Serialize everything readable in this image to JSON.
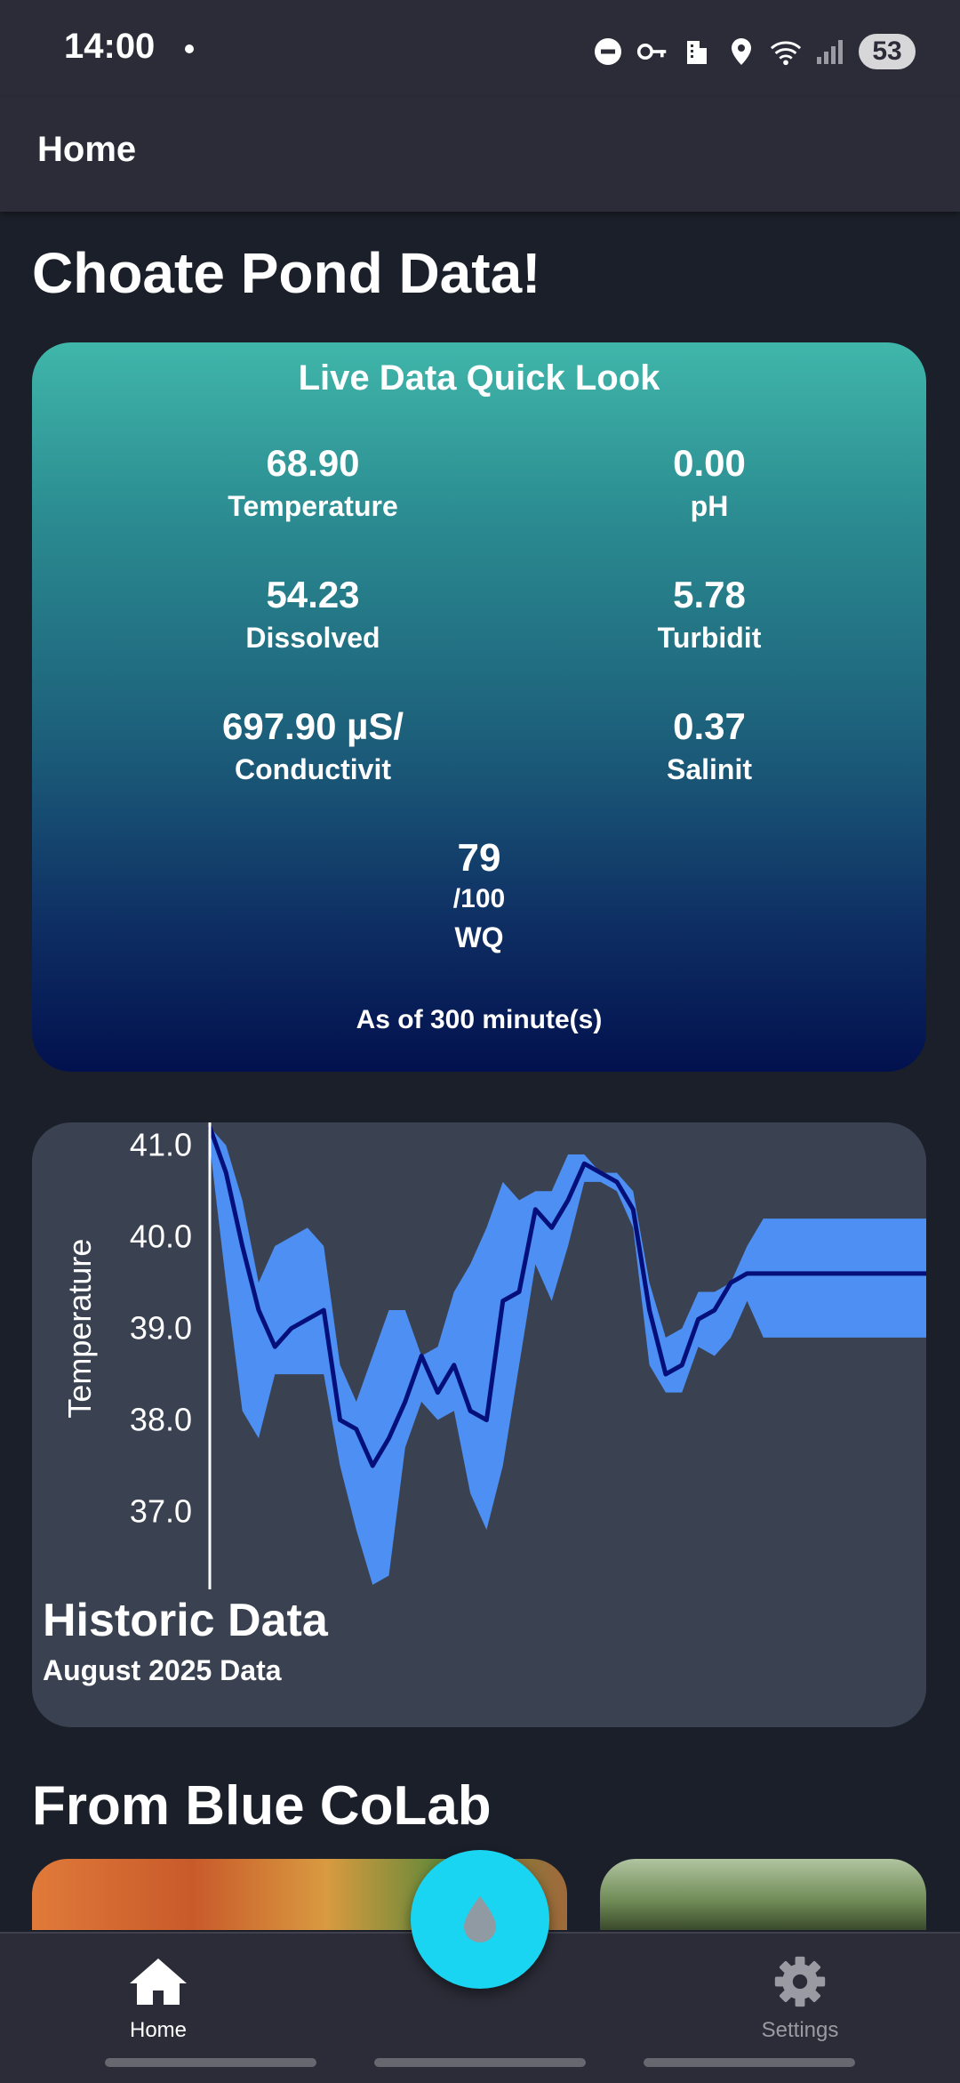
{
  "status_bar": {
    "time": "14:00",
    "battery": "53",
    "icons": [
      "dnd-icon",
      "vpn-key-icon",
      "building-icon",
      "location-icon",
      "wifi-icon",
      "signal-icon"
    ]
  },
  "app_bar": {
    "title": "Home"
  },
  "page": {
    "title": "Choate Pond Data!"
  },
  "live_data": {
    "title": "Live Data Quick Look",
    "metrics": [
      {
        "value": "68.90",
        "label": "Temperature"
      },
      {
        "value": "0.00",
        "label": "pH"
      },
      {
        "value": "54.23",
        "label": "Dissolved"
      },
      {
        "value": "5.78",
        "label": "Turbidit"
      },
      {
        "value": "697.90 µS/",
        "label": "Conductivit"
      },
      {
        "value": "0.37",
        "label": "Salinit"
      }
    ],
    "wq": {
      "value": "79",
      "sub": "/100",
      "label": "WQ"
    },
    "as_of": "As of 300 minute(s)"
  },
  "historic": {
    "title": "Historic Data",
    "subtitle": "August 2025 Data"
  },
  "chart_data": {
    "type": "line",
    "ylabel": "Temperature",
    "yticks": [
      "41.0",
      "40.0",
      "39.0",
      "38.0",
      "37.0"
    ],
    "ylim": [
      36.15,
      41.25
    ],
    "x": [
      1,
      2,
      3,
      4,
      5,
      6,
      7,
      8,
      9,
      10,
      11,
      12,
      13,
      14,
      15,
      16,
      17,
      18,
      19,
      20,
      21,
      22,
      23,
      24,
      25,
      26,
      27,
      28,
      29,
      30,
      31,
      32,
      33,
      34,
      35,
      36,
      37,
      38,
      39,
      40,
      41,
      42,
      43,
      44,
      45
    ],
    "series": [
      {
        "values": [
          41.2,
          40.7,
          39.9,
          39.2,
          38.8,
          39.0,
          39.1,
          39.2,
          38.0,
          37.9,
          37.5,
          37.8,
          38.2,
          38.7,
          38.3,
          38.6,
          38.1,
          38.0,
          39.3,
          39.4,
          40.3,
          40.1,
          40.4,
          40.8,
          40.7,
          40.6,
          40.3,
          39.2,
          38.5,
          38.6,
          39.1,
          39.2,
          39.5,
          39.6,
          39.6,
          39.6,
          39.6,
          39.6,
          39.6,
          39.6,
          39.6,
          39.6,
          39.6,
          39.6,
          39.6
        ],
        "lower": [
          41.0,
          39.5,
          38.1,
          37.8,
          38.5,
          38.5,
          38.5,
          38.5,
          37.5,
          36.8,
          36.2,
          36.3,
          37.7,
          38.2,
          38.0,
          38.1,
          37.2,
          36.8,
          37.5,
          38.6,
          39.7,
          39.3,
          39.9,
          40.6,
          40.6,
          40.5,
          40.1,
          38.6,
          38.3,
          38.3,
          38.8,
          38.7,
          38.9,
          39.3,
          38.9,
          38.9,
          38.9,
          38.9,
          38.9,
          38.9,
          38.9,
          38.9,
          38.9,
          38.9,
          38.9
        ],
        "upper": [
          41.2,
          41.0,
          40.4,
          39.5,
          39.9,
          40.0,
          40.1,
          39.9,
          38.6,
          38.2,
          38.7,
          39.2,
          39.2,
          38.7,
          38.8,
          39.4,
          39.7,
          40.1,
          40.6,
          40.4,
          40.5,
          40.5,
          40.9,
          40.9,
          40.7,
          40.7,
          40.5,
          39.5,
          38.9,
          39.0,
          39.4,
          39.4,
          39.5,
          39.9,
          40.2,
          40.2,
          40.2,
          40.2,
          40.2,
          40.2,
          40.2,
          40.2,
          40.2,
          40.2,
          40.2
        ]
      }
    ],
    "colors": {
      "line": "#050f7a",
      "band": "#4d8ff2",
      "axis": "#ffffff"
    },
    "grid": false
  },
  "section": {
    "title": "From Blue CoLab"
  },
  "bottom_nav": {
    "items": [
      {
        "label": "Home"
      },
      {
        "label": "Settings"
      }
    ],
    "fab_icon": "water-drop-icon"
  }
}
